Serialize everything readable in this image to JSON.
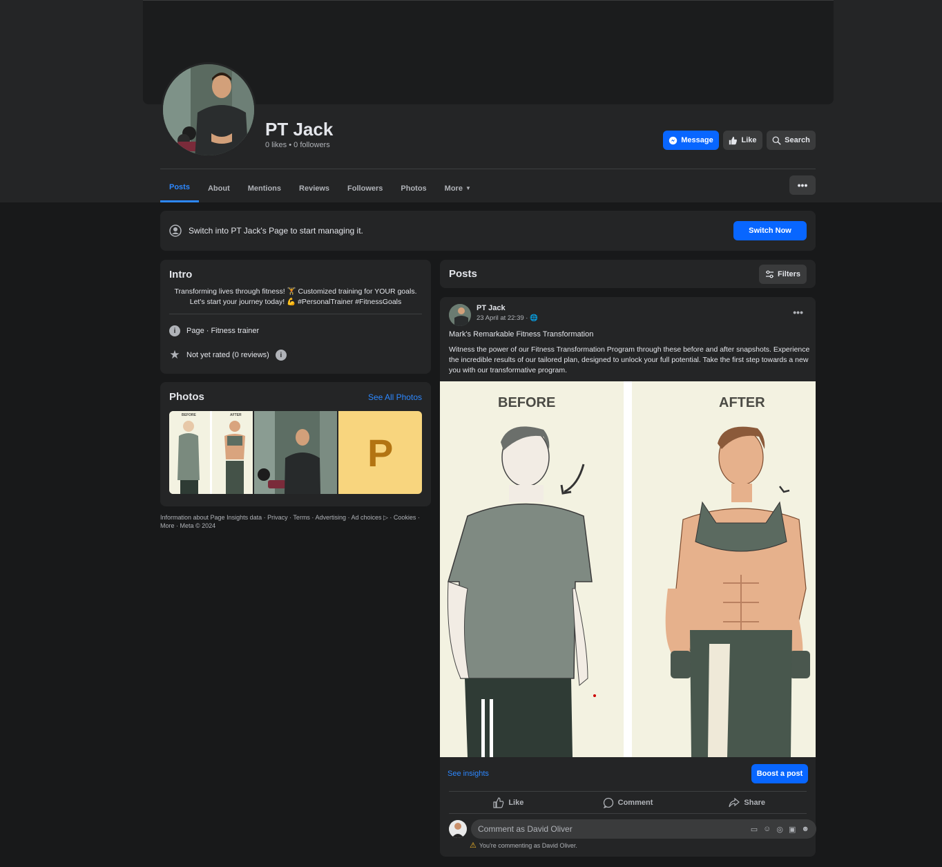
{
  "page": {
    "name": "PT Jack",
    "stats": "0 likes • 0 followers"
  },
  "header_buttons": {
    "message": "Message",
    "like": "Like",
    "search": "Search"
  },
  "tabs": [
    {
      "label": "Posts",
      "active": true
    },
    {
      "label": "About"
    },
    {
      "label": "Mentions"
    },
    {
      "label": "Reviews"
    },
    {
      "label": "Followers"
    },
    {
      "label": "Photos"
    },
    {
      "label": "More"
    }
  ],
  "switch_banner": {
    "text": "Switch into PT Jack's Page to start managing it.",
    "button": "Switch Now"
  },
  "intro": {
    "title": "Intro",
    "bio": "Transforming lives through fitness! 🏋️ Customized training for YOUR goals. Let's start your journey today! 💪 #PersonalTrainer #FitnessGoals",
    "category": "Page · Fitness trainer",
    "rating": "Not yet rated (0 reviews)"
  },
  "photos": {
    "title": "Photos",
    "see_all": "See All Photos",
    "thumb_before": "BEFORE",
    "thumb_after": "AFTER",
    "thumb_p": "P"
  },
  "footer": "Information about Page Insights data · Privacy · Terms · Advertising · Ad choices ▷ · Cookies · More · Meta © 2024",
  "posts_header": {
    "title": "Posts",
    "filters": "Filters"
  },
  "post": {
    "author": "PT Jack",
    "time": "23 April at 22:39 · ",
    "title": "Mark's Remarkable Fitness Transformation",
    "body": "Witness the power of our Fitness Transformation Program through these before and after snapshots. Experience the incredible results of our tailored plan, designed to unlock your full potential. Take the first step towards a new you with our transformative program.",
    "image_before": "BEFORE",
    "image_after": "AFTER",
    "see_insights": "See insights",
    "boost": "Boost a post",
    "like": "Like",
    "comment": "Comment",
    "share": "Share",
    "comment_placeholder": "Comment as David Oliver",
    "commenting_as": "You're commenting as David Oliver."
  },
  "colors": {
    "accent": "#0866ff",
    "link": "#2d88ff",
    "bg": "#18191a",
    "card": "#242526"
  }
}
